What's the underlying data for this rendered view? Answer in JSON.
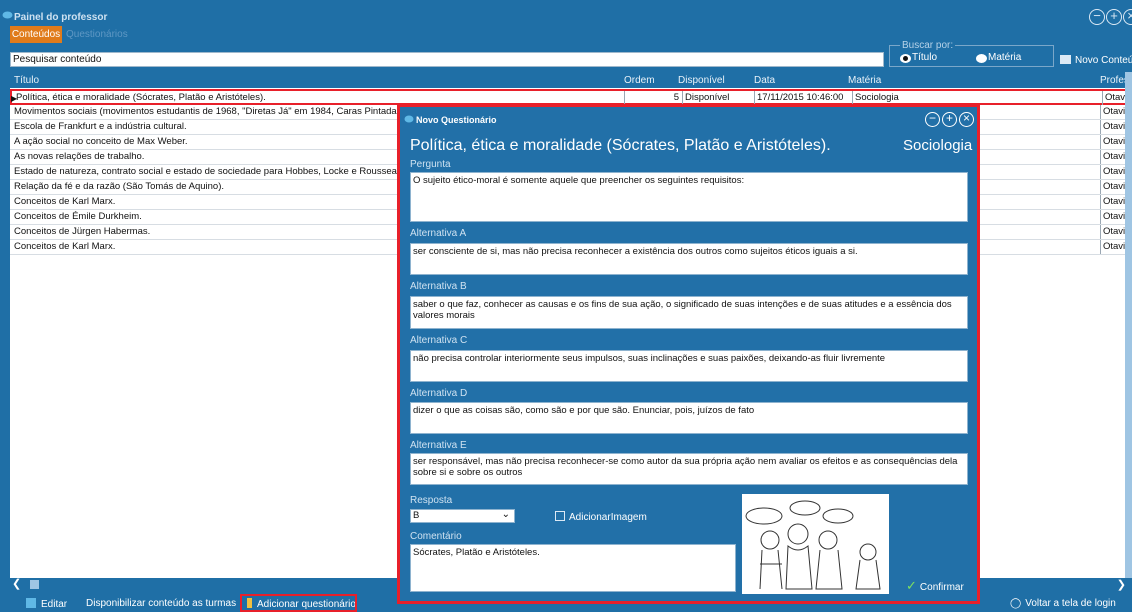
{
  "app": {
    "title": "Painel do professor"
  },
  "tabs": [
    {
      "label": "Conteúdos"
    },
    {
      "label": "Questionários"
    }
  ],
  "search": {
    "value": "Pesquisar conteúdo",
    "search_by": "Buscar por:",
    "options": [
      "Título",
      "Matéria"
    ],
    "selected": "Título"
  },
  "new_content": "Novo Conteúdo",
  "table": {
    "headers": [
      "Título",
      "Ordem",
      "Disponível",
      "Data",
      "Matéria",
      "Profes"
    ],
    "selected_row": {
      "title": "Política, ética e moralidade (Sócrates, Platão e Aristóteles).",
      "order": "5",
      "available": "Disponível",
      "date": "17/11/2015 10:46:00",
      "subject": "Sociologia",
      "prof": "Otavio"
    },
    "rows": [
      {
        "title": "Movimentos sociais (movimentos estudantis de 1968, \"Diretas Já\" em 1984, Caras Pintadas",
        "prof": "Otavio"
      },
      {
        "title": "Escola de Frankfurt e a indústria cultural.",
        "prof": "Otavio"
      },
      {
        "title": "A ação social no conceito de Max Weber.",
        "prof": "Otavio"
      },
      {
        "title": "As novas relações de trabalho.",
        "prof": "Otavio"
      },
      {
        "title": "Estado de natureza, contrato social e estado de sociedade para Hobbes, Locke e Rousseau.",
        "prof": "Otavio"
      },
      {
        "title": "Relação da fé e da razão (São Tomás de Aquino).",
        "prof": "Otavio"
      },
      {
        "title": "Conceitos de Karl Marx.",
        "prof": "Otavio"
      },
      {
        "title": "Conceitos de Émile Durkheim.",
        "prof": "Otavio"
      },
      {
        "title": "Conceitos de Jürgen Habermas.",
        "prof": "Otavio"
      },
      {
        "title": "Conceitos de Karl Marx.",
        "prof": "Otavio"
      }
    ]
  },
  "bottom": {
    "edit": "Editar",
    "publish": "Disponibilizar conteúdo as turmas",
    "add_questionnaire": "Adicionar questionário",
    "back_login": "Voltar a tela de login"
  },
  "modal": {
    "title": "Novo Questionário",
    "heading": "Política, ética e moralidade (Sócrates, Platão e Aristóteles).",
    "subject": "Sociologia",
    "question_label": "Pergunta",
    "question": "O sujeito ético-moral é somente aquele que preencher os seguintes requisitos:",
    "alt_a_label": "Alternativa A",
    "alt_a": "ser consciente de si, mas não precisa reconhecer a existência dos outros como sujeitos éticos iguais a si.",
    "alt_b_label": "Alternativa B",
    "alt_b": "saber o que faz, conhecer as causas e os fins de sua ação, o significado de suas intenções e de suas atitudes e a essência dos valores morais",
    "alt_c_label": "Alternativa C",
    "alt_c": "não precisa controlar interiormente seus impulsos, suas inclinações e suas paixões, deixando-as fluir livremente",
    "alt_d_label": "Alternativa D",
    "alt_d": "dizer o que as coisas são, como são e por que são. Enunciar, pois, juízos de fato",
    "alt_e_label": "Alternativa E",
    "alt_e": "ser responsável, mas não precisa reconhecer-se como autor da sua própria ação nem avaliar os efeitos e as consequências dela sobre si e sobre os outros",
    "answer_label": "Resposta",
    "answer": "B",
    "add_image": "AdicionarImagem",
    "comment_label": "Comentário",
    "comment": "Sócrates, Platão e Aristóteles.",
    "confirm": "Confirmar"
  }
}
